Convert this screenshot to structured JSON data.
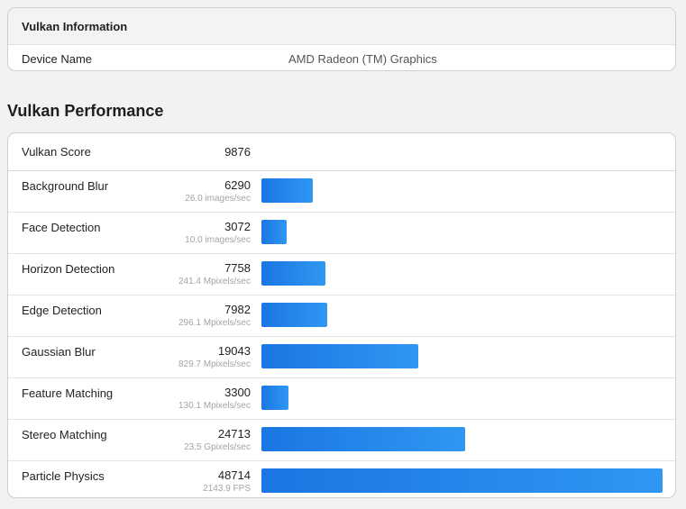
{
  "info": {
    "title": "Vulkan Information",
    "device_label": "Device Name",
    "device_value": "AMD Radeon (TM) Graphics"
  },
  "performance": {
    "title": "Vulkan Performance",
    "score_label": "Vulkan Score",
    "score_value": "9876",
    "max_value": 48714,
    "tests": [
      {
        "name": "Background Blur",
        "score": "6290",
        "rate": "26.0 images/sec",
        "value": 6290
      },
      {
        "name": "Face Detection",
        "score": "3072",
        "rate": "10.0 images/sec",
        "value": 3072
      },
      {
        "name": "Horizon Detection",
        "score": "7758",
        "rate": "241.4 Mpixels/sec",
        "value": 7758
      },
      {
        "name": "Edge Detection",
        "score": "7982",
        "rate": "296.1 Mpixels/sec",
        "value": 7982
      },
      {
        "name": "Gaussian Blur",
        "score": "19043",
        "rate": "829.7 Mpixels/sec",
        "value": 19043
      },
      {
        "name": "Feature Matching",
        "score": "3300",
        "rate": "130.1 Mpixels/sec",
        "value": 3300
      },
      {
        "name": "Stereo Matching",
        "score": "24713",
        "rate": "23.5 Gpixels/sec",
        "value": 24713
      },
      {
        "name": "Particle Physics",
        "score": "48714",
        "rate": "2143.9 FPS",
        "value": 48714
      }
    ]
  }
}
